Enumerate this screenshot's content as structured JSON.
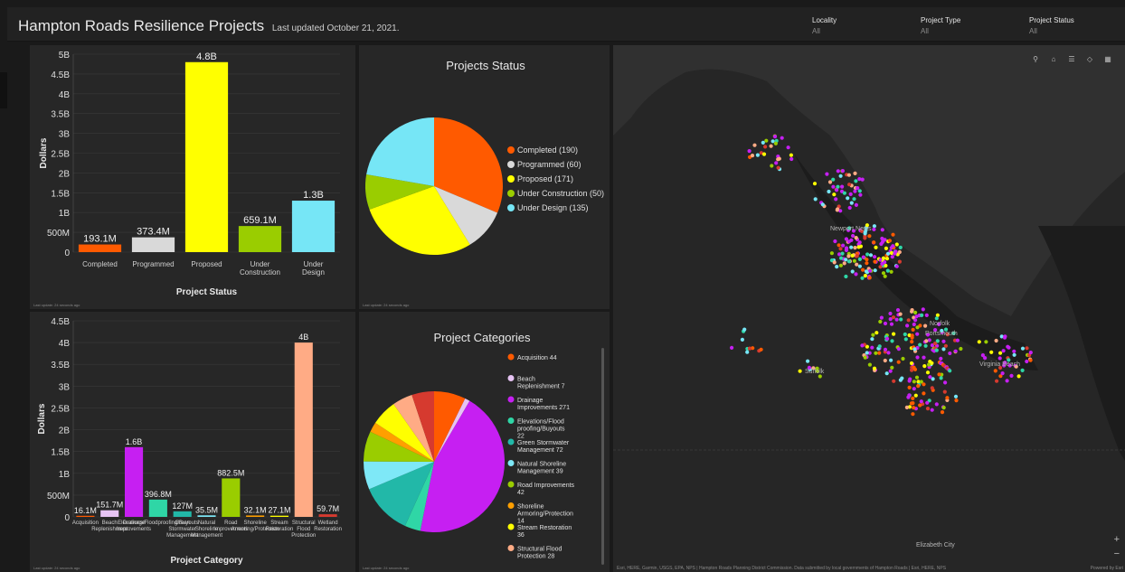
{
  "header": {
    "title": "Hampton Roads Resilience Projects",
    "updated": "Last updated October 21, 2021.",
    "filters": [
      {
        "label": "Locality",
        "value": "All"
      },
      {
        "label": "Project Type",
        "value": "All"
      },
      {
        "label": "Project Status",
        "value": "All"
      }
    ]
  },
  "panels": {
    "status_bar_footnote": "Last update: 24 seconds ago",
    "status_pie_footnote": "Last update: 24 seconds ago",
    "category_bar_footnote": "Last update: 24 seconds ago",
    "category_pie_footnote": "Last update: 24 seconds ago"
  },
  "map": {
    "tools": [
      "search-icon",
      "home-icon",
      "list-icon",
      "layers-icon",
      "grid-icon"
    ],
    "zoom_in": "+",
    "zoom_out": "−",
    "cities": [
      "Newport News",
      "Norfolk",
      "Portsmouth",
      "Suffolk",
      "Virginia Beach",
      "Elizabeth City"
    ],
    "attribution": "Esri, HERE, Garmin, USGS, EPA, NPS | Hampton Roads Planning District Commission. Data submitted by local governments of Hampton Roads | Esri, HERE, NPS",
    "powered": "Powered by Esri"
  },
  "chart_data": [
    {
      "type": "bar",
      "categories": [
        "Completed",
        "Programmed",
        "Proposed",
        "Under Construction",
        "Under Design"
      ],
      "values": [
        193100000,
        373400000,
        4800000000,
        659100000,
        1300000000
      ],
      "data_labels": [
        "193.1M",
        "373.4M",
        "4.8B",
        "659.1M",
        "1.3B"
      ],
      "colors": [
        "#ff5a00",
        "#d9d9d9",
        "#ffff00",
        "#9acd00",
        "#76e6f6"
      ],
      "ylim": [
        0,
        5000000000
      ],
      "yticks": [
        "0",
        "500M",
        "1B",
        "1.5B",
        "2B",
        "2.5B",
        "3B",
        "3.5B",
        "4B",
        "4.5B",
        "5B"
      ],
      "xlabel": "Project Status",
      "ylabel": "Dollars",
      "grid": true
    },
    {
      "type": "pie",
      "title": "Projects Status",
      "labels": [
        "Completed",
        "Programmed",
        "Proposed",
        "Under Construction",
        "Under Design"
      ],
      "values": [
        190,
        60,
        171,
        50,
        135
      ],
      "legend": [
        "Completed (190)",
        "Programmed (60)",
        "Proposed (171)",
        "Under Construction (50)",
        "Under Design (135)"
      ],
      "colors": [
        "#ff5a00",
        "#d9d9d9",
        "#ffff00",
        "#9acd00",
        "#76e6f6"
      ],
      "legend_position": "right"
    },
    {
      "type": "bar",
      "categories": [
        "Acquisition",
        "Beach Replenishment",
        "Drainage Improvements",
        "Elevations/Floodproofing/Buyouts",
        "Green Stormwater Management",
        "Natural Shoreline Management",
        "Road Improvements",
        "Shoreline Armoring/Protection",
        "Stream Restoration",
        "Structural Flood Protection",
        "Wetland Restoration"
      ],
      "values": [
        16100000,
        151700000,
        1600000000,
        396800000,
        127000000,
        35500000,
        882500000,
        32100000,
        27100000,
        4000000000,
        59700000
      ],
      "data_labels": [
        "16.1M",
        "151.7M",
        "1.6B",
        "396.8M",
        "127M",
        "35.5M",
        "882.5M",
        "32.1M",
        "27.1M",
        "4B",
        "59.7M"
      ],
      "colors": [
        "#ff5a00",
        "#e6c3f3",
        "#c61ff2",
        "#2fd6a6",
        "#22b8a8",
        "#7ee8f7",
        "#9acd00",
        "#ff9f00",
        "#ffff00",
        "#ffab85",
        "#d63a2f"
      ],
      "ylim": [
        0,
        4500000000
      ],
      "yticks": [
        "0",
        "500M",
        "1B",
        "1.5B",
        "2B",
        "2.5B",
        "3B",
        "3.5B",
        "4B",
        "4.5B"
      ],
      "xlabel": "Project Category",
      "ylabel": "Dollars",
      "grid": true
    },
    {
      "type": "pie",
      "title": "Project Categories",
      "labels": [
        "Acquisition",
        "Beach Replenishment",
        "Drainage Improvements",
        "Elevations/Flood proofing/Buyouts",
        "Green Stormwater Management",
        "Natural Shoreline Management",
        "Road Improvements",
        "Shoreline Armoring/Protection",
        "Stream Restoration",
        "Structural Flood Protection",
        "Wetland Restoration"
      ],
      "values": [
        44,
        7,
        271,
        22,
        72,
        39,
        42,
        14,
        36,
        28,
        31
      ],
      "legend": [
        "Acquisition 44",
        "Beach Replenishment 7",
        "Drainage Improvements 271",
        "Elevations/Flood proofing/Buyouts 22",
        "Green Stormwater Management 72",
        "Natural Shoreline Management 39",
        "Road Improvements 42",
        "Shoreline Armoring/Protection 14",
        "Stream Restoration 36",
        "Structural Flood Protection 28"
      ],
      "colors": [
        "#ff5a00",
        "#e6c3f3",
        "#c61ff2",
        "#2fd6a6",
        "#22b8a8",
        "#7ee8f7",
        "#9acd00",
        "#ff9f00",
        "#ffff00",
        "#ffab85",
        "#d63a2f"
      ],
      "legend_position": "right"
    }
  ]
}
